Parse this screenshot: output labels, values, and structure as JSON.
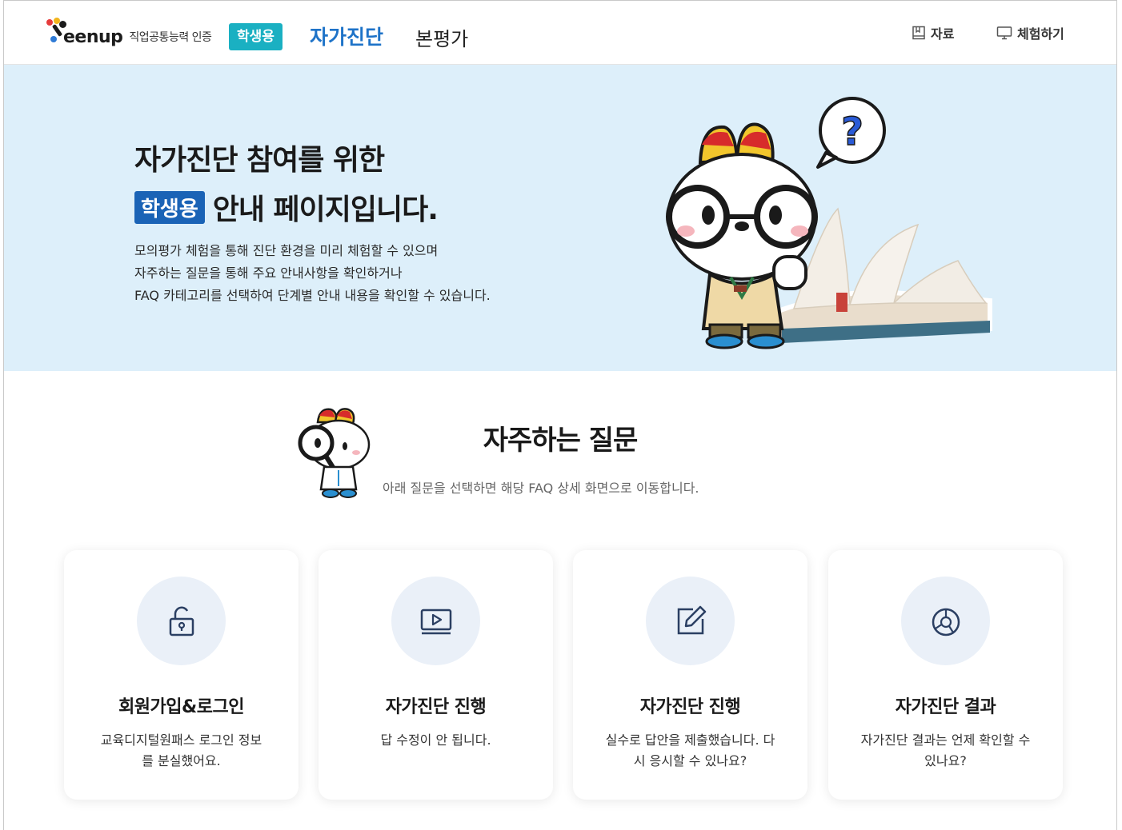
{
  "header": {
    "logo_text": "eenup",
    "logo_sub": "직업공통능력 인증",
    "badge": "학생용",
    "nav_active": "자가진단",
    "nav_second": "본평가",
    "util_resources": "자료",
    "util_experience": "체험하기"
  },
  "hero": {
    "title_line1": "자가진단 참여를 위한",
    "title_badge": "학생용",
    "title_line2": "안내 페이지입니다.",
    "desc": [
      "모의평가 체험을 통해 진단 환경을 미리 체험할 수 있으며",
      "자주하는 질문을 통해 주요 안내사항을 확인하거나",
      "FAQ 카테고리를 선택하여 단계별 안내 내용을 확인할 수 있습니다."
    ]
  },
  "faq": {
    "title": "자주하는 질문",
    "subtitle": "아래 질문을 선택하면 해당 FAQ 상세 화면으로 이동합니다.",
    "cards": [
      {
        "icon": "unlock-icon",
        "title": "회원가입&로그인",
        "desc_lines": [
          "교육디지털원패스 로그인 정보",
          "를 분실했어요."
        ]
      },
      {
        "icon": "video-play-icon",
        "title": "자가진단 진행",
        "desc_lines": [
          "답 수정이 안 됩니다."
        ]
      },
      {
        "icon": "edit-icon",
        "title": "자가진단 진행",
        "desc_lines": [
          "실수로 답안을 제출했습니다. 다",
          "시 응시할 수 있나요?"
        ]
      },
      {
        "icon": "pie-chart-icon",
        "title": "자가진단 결과",
        "desc_lines": [
          "자가진단 결과는 언제 확인할 수",
          "있나요?"
        ]
      }
    ]
  },
  "colors": {
    "accent_blue": "#1e73c8",
    "badge_teal": "#1ab0c2",
    "hero_bg": "#ddeffa",
    "hero_badge": "#1a63b6"
  }
}
